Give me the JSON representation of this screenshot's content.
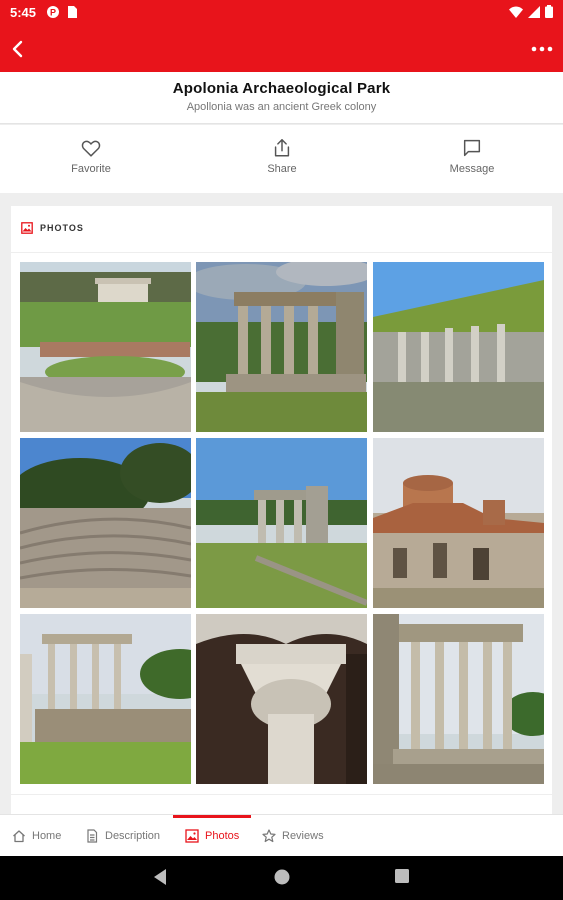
{
  "status_bar": {
    "time": "5:45",
    "icons": [
      "notification-icon",
      "sim-icon"
    ],
    "right_icons": [
      "wifi-icon",
      "signal-icon",
      "battery-icon"
    ]
  },
  "app_bar": {
    "color": "#e8141b",
    "back_icon": "back-arrow-icon",
    "more_icon": "more-options-icon"
  },
  "header": {
    "title": "Apolonia Archaeological Park",
    "subtitle": "Apollonia was an ancient Greek colony"
  },
  "actions": [
    {
      "label": "Favorite",
      "icon": "heart-icon"
    },
    {
      "label": "Share",
      "icon": "share-icon"
    },
    {
      "label": "Message",
      "icon": "message-icon"
    }
  ],
  "photos_section": {
    "heading": "PHOTOS",
    "icon": "image-icon",
    "photos": [
      {
        "name": "photo-theatre-ruins"
      },
      {
        "name": "photo-monument-agonothetes"
      },
      {
        "name": "photo-stoa-wall"
      },
      {
        "name": "photo-odeon-seats"
      },
      {
        "name": "photo-ruins-field"
      },
      {
        "name": "photo-monastery-church"
      },
      {
        "name": "photo-columns-ruins"
      },
      {
        "name": "photo-carved-capital"
      },
      {
        "name": "photo-temple-columns"
      }
    ]
  },
  "tabs": [
    {
      "label": "Home",
      "icon": "home-icon",
      "active": false
    },
    {
      "label": "Description",
      "icon": "document-icon",
      "active": false
    },
    {
      "label": "Photos",
      "icon": "image-icon",
      "active": true
    },
    {
      "label": "Reviews",
      "icon": "star-icon",
      "active": false
    }
  ],
  "nav_bar": {
    "buttons": [
      "nav-back-icon",
      "nav-home-icon",
      "nav-recents-icon"
    ]
  }
}
